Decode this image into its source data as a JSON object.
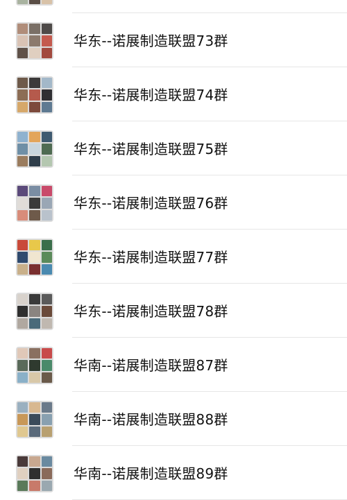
{
  "groups": [
    {
      "name": "",
      "avatar_colors": [
        "#6b5a48",
        "#c9b08a",
        "#8a8f96",
        "#3d4a5c",
        "#e2d2bd",
        "#7b6a55",
        "#a9b3a0",
        "#5a4e46",
        "#d8c2a8"
      ]
    },
    {
      "name": "华东--诺展制造联盟73群",
      "avatar_colors": [
        "#b08d7a",
        "#7a6f66",
        "#4e4a48",
        "#d9c3b5",
        "#8c7a6d",
        "#c45a4e",
        "#5f5148",
        "#e0cfc0",
        "#a2493e"
      ]
    },
    {
      "name": "华东--诺展制造联盟74群",
      "avatar_colors": [
        "#6e5a4a",
        "#3c3a3a",
        "#a3b8c9",
        "#8c6d55",
        "#b55a4c",
        "#2f2f33",
        "#d6a86a",
        "#7d4a3c",
        "#5e7a92"
      ]
    },
    {
      "name": "华东--诺展制造联盟75群",
      "avatar_colors": [
        "#8fb2cf",
        "#e3a55a",
        "#3e5a70",
        "#6f8fa6",
        "#c9d6dd",
        "#4f6b52",
        "#9a7c5e",
        "#2f3e4a",
        "#b4c7b0"
      ]
    },
    {
      "name": "华东--诺展制造联盟76群",
      "avatar_colors": [
        "#5b4a7a",
        "#7a8da3",
        "#c94a6a",
        "#e0dcd8",
        "#3b3b3b",
        "#9aa7b5",
        "#d88c7a",
        "#6e5a4a",
        "#b9c2cc"
      ]
    },
    {
      "name": "华东--诺展制造联盟77群",
      "avatar_colors": [
        "#c94a3a",
        "#e8c84a",
        "#3a6e4a",
        "#2f4a6e",
        "#f0e6d0",
        "#5a8a5a",
        "#c9b08a",
        "#7a2f2f",
        "#4a8ab0"
      ]
    },
    {
      "name": "华东--诺展制造联盟78群",
      "avatar_colors": [
        "#d8d2cc",
        "#3a3a3a",
        "#5a5a5a",
        "#2f2f2f",
        "#8a8480",
        "#6a4a3a",
        "#b0a8a0",
        "#4a6a7a",
        "#c0b8b0"
      ]
    },
    {
      "name": "华南--诺展制造联盟87群",
      "avatar_colors": [
        "#e0c8b8",
        "#8a7060",
        "#c84a4a",
        "#5a6a5a",
        "#2f3a2f",
        "#4a8a6a",
        "#8ab0c8",
        "#d8c8a8",
        "#6a5a4a"
      ]
    },
    {
      "name": "华南--诺展制造联盟88群",
      "avatar_colors": [
        "#9ab0c0",
        "#d8b890",
        "#6a7a8a",
        "#c89858",
        "#3a4a5a",
        "#88a0b0",
        "#e0c890",
        "#5a6a7a",
        "#b8a070"
      ]
    },
    {
      "name": "华南--诺展制造联盟89群",
      "avatar_colors": [
        "#4a3a3a",
        "#c8a890",
        "#6a8aa0",
        "#e0d0c0",
        "#2f2f2f",
        "#8a6a5a",
        "#5a7a5a",
        "#c87a6a",
        "#9aa8b0"
      ]
    }
  ]
}
